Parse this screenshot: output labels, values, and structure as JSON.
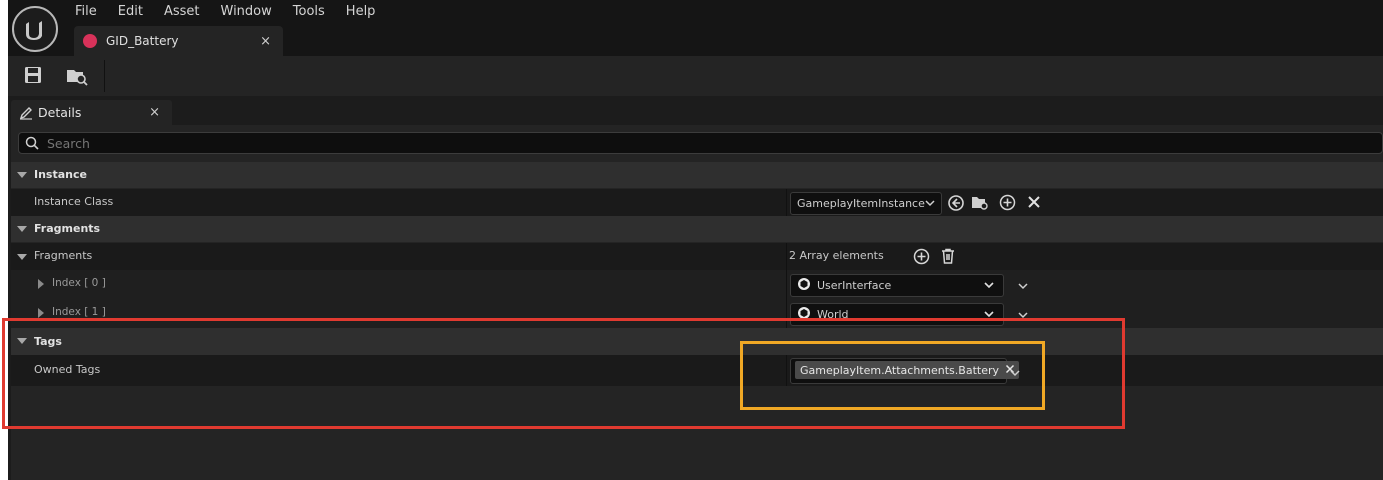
{
  "menu": [
    "File",
    "Edit",
    "Asset",
    "Window",
    "Tools",
    "Help"
  ],
  "document_tab": {
    "label": "GID_Battery",
    "close": "×"
  },
  "details_tab": {
    "label": "Details",
    "close": "×"
  },
  "search": {
    "placeholder": "Search",
    "value": ""
  },
  "sections": {
    "instance": {
      "label": "Instance",
      "instance_class": {
        "label": "Instance Class",
        "value": "GameplayItemInstance"
      }
    },
    "fragments": {
      "label": "Fragments",
      "fragments_prop": {
        "label": "Fragments",
        "value": "2 Array elements"
      },
      "items": [
        {
          "label": "Index [ 0 ]",
          "value": "UserInterface"
        },
        {
          "label": "Index [ 1 ]",
          "value": "World"
        }
      ]
    },
    "tags": {
      "label": "Tags",
      "owned_tags": {
        "label": "Owned Tags",
        "tag": "GameplayItem.Attachments.Battery"
      }
    }
  },
  "colors": {
    "highlight_red": "#e03a30",
    "highlight_orange": "#f0a825",
    "asset_icon": "#d8325a"
  }
}
